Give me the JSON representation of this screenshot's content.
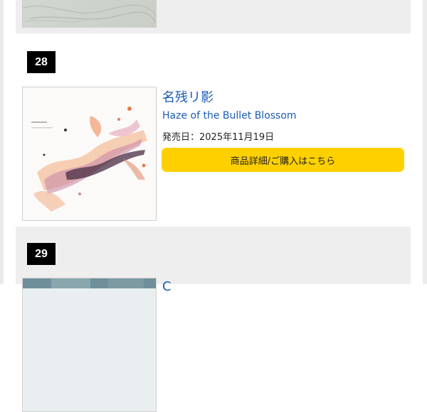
{
  "items": [
    {
      "rank": "",
      "cover_alt": "album-cover-27"
    },
    {
      "rank": "28",
      "title_jp": "名残リ影",
      "title_en": "Haze of the Bullet Blossom",
      "release_label": "発売日：",
      "release_date": "2025年11月19日",
      "button_label": "商品詳細/ご購入はこちら"
    },
    {
      "rank": "29",
      "title_partial": "C"
    }
  ],
  "colors": {
    "link": "#1a5bb5",
    "button": "#ffd000",
    "badge": "#000000",
    "gray_row": "#eeeeee"
  }
}
